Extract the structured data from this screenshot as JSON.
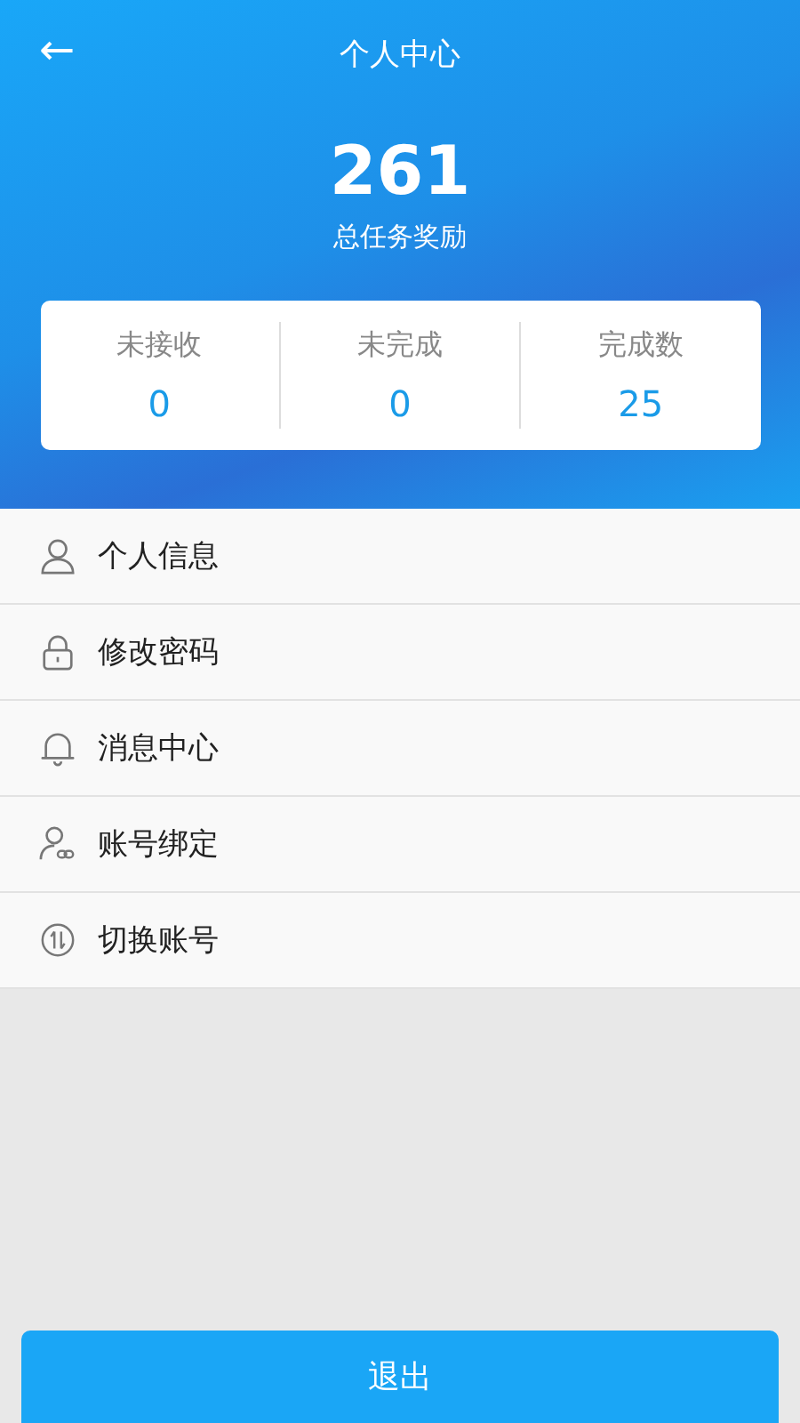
{
  "header": {
    "back": "←",
    "title": "个人中心"
  },
  "reward": {
    "value": "261",
    "label": "总任务奖励"
  },
  "stats": [
    {
      "label": "未接收",
      "value": "0"
    },
    {
      "label": "未完成",
      "value": "0"
    },
    {
      "label": "完成数",
      "value": "25"
    }
  ],
  "menu": [
    {
      "label": "个人信息"
    },
    {
      "label": "修改密码"
    },
    {
      "label": "消息中心"
    },
    {
      "label": "账号绑定"
    },
    {
      "label": "切换账号"
    }
  ],
  "logout": "退出"
}
